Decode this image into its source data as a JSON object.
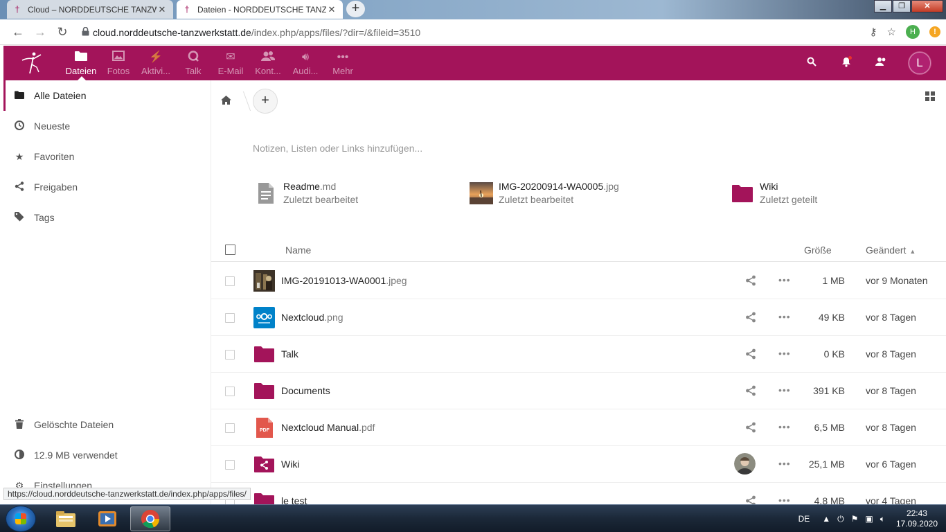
{
  "browser": {
    "tabs": [
      {
        "title": "Cloud – NORDDEUTSCHE TANZW",
        "active": false
      },
      {
        "title": "Dateien - NORDDEUTSCHE TANZ",
        "active": true
      }
    ],
    "url_host": "cloud.norddeutsche-tanzwerkstatt.de",
    "url_path": "/index.php/apps/files/?dir=/&fileid=3510",
    "extension_badge": "H",
    "alert_badge": "!",
    "status_url": "https://cloud.norddeutsche-tanzwerkstatt.de/index.php/apps/files/"
  },
  "header": {
    "accent": "#a3145a",
    "apps": [
      {
        "label": "Dateien",
        "icon": "folder-icon",
        "active": true
      },
      {
        "label": "Fotos",
        "icon": "image-icon",
        "active": false
      },
      {
        "label": "Aktivi...",
        "icon": "activity-icon",
        "active": false
      },
      {
        "label": "Talk",
        "icon": "talk-icon",
        "active": false
      },
      {
        "label": "E-Mail",
        "icon": "mail-icon",
        "active": false
      },
      {
        "label": "Kont...",
        "icon": "contacts-icon",
        "active": false
      },
      {
        "label": "Audi...",
        "icon": "audio-icon",
        "active": false
      },
      {
        "label": "Mehr",
        "icon": "more-icon",
        "active": false
      }
    ],
    "avatar_initial": "L"
  },
  "sidebar": {
    "items": [
      {
        "label": "Alle Dateien",
        "icon": "folder-icon",
        "active": true
      },
      {
        "label": "Neueste",
        "icon": "clock-icon",
        "active": false
      },
      {
        "label": "Favoriten",
        "icon": "star-icon",
        "active": false
      },
      {
        "label": "Freigaben",
        "icon": "share-icon",
        "active": false
      },
      {
        "label": "Tags",
        "icon": "tag-icon",
        "active": false
      }
    ],
    "bottom": [
      {
        "label": "Gelöschte Dateien",
        "icon": "trash-icon"
      },
      {
        "label": "12.9 MB verwendet",
        "icon": "quota-icon"
      },
      {
        "label": "Einstellungen",
        "icon": "settings-icon"
      }
    ]
  },
  "main": {
    "notes_placeholder": "Notizen, Listen oder Links hinzufügen...",
    "recent": [
      {
        "name": "Readme",
        "ext": ".md",
        "sub": "Zuletzt bearbeitet",
        "icon": "text-file-icon"
      },
      {
        "name": "IMG-20200914-WA0005",
        "ext": ".jpg",
        "sub": "Zuletzt bearbeitet",
        "icon": "image-thumbnail"
      },
      {
        "name": "Wiki",
        "ext": "",
        "sub": "Zuletzt geteilt",
        "icon": "folder-icon"
      }
    ],
    "columns": {
      "name": "Name",
      "size": "Größe",
      "modified": "Geändert"
    },
    "files": [
      {
        "name": "IMG-20191013-WA0001",
        "ext": ".jpeg",
        "size": "1 MB",
        "modified": "vor 9 Monaten",
        "icon": "photo-thumbnail",
        "shared_by_avatar": false
      },
      {
        "name": "Nextcloud",
        "ext": ".png",
        "size": "49 KB",
        "modified": "vor 8 Tagen",
        "icon": "nextcloud-logo-thumbnail",
        "shared_by_avatar": false
      },
      {
        "name": "Talk",
        "ext": "",
        "size": "0 KB",
        "modified": "vor 8 Tagen",
        "icon": "folder-icon",
        "shared_by_avatar": false
      },
      {
        "name": "Documents",
        "ext": "",
        "size": "391 KB",
        "modified": "vor 8 Tagen",
        "icon": "folder-icon",
        "shared_by_avatar": false
      },
      {
        "name": "Nextcloud Manual",
        "ext": ".pdf",
        "size": "6,5 MB",
        "modified": "vor 8 Tagen",
        "icon": "pdf-icon",
        "shared_by_avatar": false
      },
      {
        "name": "Wiki",
        "ext": "",
        "size": "25,1 MB",
        "modified": "vor 6 Tagen",
        "icon": "shared-folder-icon",
        "shared_by_avatar": true
      },
      {
        "name": "le test",
        "ext": "",
        "size": "4,8 MB",
        "modified": "vor 4 Tagen",
        "icon": "folder-icon",
        "shared_by_avatar": false
      }
    ]
  },
  "taskbar": {
    "language": "DE",
    "time": "22:43",
    "date": "17.09.2020"
  }
}
